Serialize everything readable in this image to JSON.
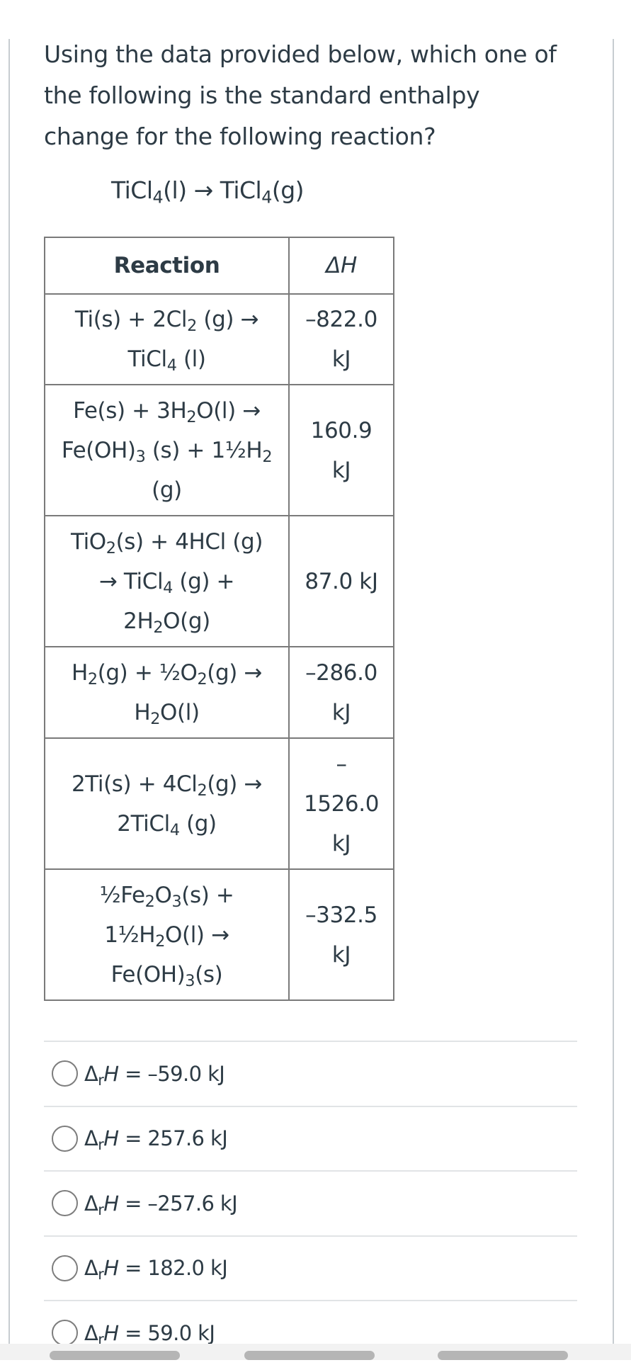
{
  "question": {
    "lines": [
      "Using the data provided below, which one of",
      "the following is the standard enthalpy",
      "change for the following reaction?"
    ],
    "equation": [
      {
        "t": "TiCl"
      },
      {
        "sub": "4"
      },
      {
        "t": "(l) → TiCl"
      },
      {
        "sub": "4"
      },
      {
        "t": "(g)"
      }
    ]
  },
  "table": {
    "headers": {
      "reaction": "Reaction",
      "delta_h": "ΔH"
    },
    "rows": [
      {
        "reaction_lines": [
          [
            {
              "t": "Ti(s) + 2Cl"
            },
            {
              "sub": "2"
            },
            {
              "t": " (g) →"
            }
          ],
          [
            {
              "t": "TiCl"
            },
            {
              "sub": "4"
            },
            {
              "t": " (l)"
            }
          ]
        ],
        "delta_h_lines": [
          "–822.0",
          "kJ"
        ]
      },
      {
        "reaction_lines": [
          [
            {
              "t": "Fe(s) + 3H"
            },
            {
              "sub": "2"
            },
            {
              "t": "O(l) →"
            }
          ],
          [
            {
              "t": "Fe(OH)"
            },
            {
              "sub": "3"
            },
            {
              "t": " (s) + 1½H"
            },
            {
              "sub": "2"
            }
          ],
          [
            {
              "t": "(g)"
            }
          ]
        ],
        "delta_h_lines": [
          "160.9",
          "kJ"
        ]
      },
      {
        "reaction_lines": [
          [
            {
              "t": "TiO"
            },
            {
              "sub": "2"
            },
            {
              "t": "(s) + 4HCl (g)"
            }
          ],
          [
            {
              "t": "→ TiCl"
            },
            {
              "sub": "4"
            },
            {
              "t": " (g) +"
            }
          ],
          [
            {
              "t": "2H"
            },
            {
              "sub": "2"
            },
            {
              "t": "O(g)"
            }
          ]
        ],
        "delta_h_lines": [
          "87.0 kJ"
        ]
      },
      {
        "reaction_lines": [
          [
            {
              "t": "H"
            },
            {
              "sub": "2"
            },
            {
              "t": "(g) + ½O"
            },
            {
              "sub": "2"
            },
            {
              "t": "(g) →"
            }
          ],
          [
            {
              "t": "H"
            },
            {
              "sub": "2"
            },
            {
              "t": "O(l)"
            }
          ]
        ],
        "delta_h_lines": [
          "–286.0",
          "kJ"
        ]
      },
      {
        "reaction_lines": [
          [
            {
              "t": "2Ti(s) + 4Cl"
            },
            {
              "sub": "2"
            },
            {
              "t": "(g) →"
            }
          ],
          [
            {
              "t": "2TiCl"
            },
            {
              "sub": "4"
            },
            {
              "t": " (g)"
            }
          ]
        ],
        "delta_h_lines": [
          "–",
          "1526.0",
          "kJ"
        ]
      },
      {
        "reaction_lines": [
          [
            {
              "t": "½Fe"
            },
            {
              "sub": "2"
            },
            {
              "t": "O"
            },
            {
              "sub": "3"
            },
            {
              "t": "(s) +"
            }
          ],
          [
            {
              "t": "1½H"
            },
            {
              "sub": "2"
            },
            {
              "t": "O(l) →"
            }
          ],
          [
            {
              "t": "Fe(OH)"
            },
            {
              "sub": "3"
            },
            {
              "t": "(s)"
            }
          ]
        ],
        "delta_h_lines": [
          "–332.5",
          "kJ"
        ]
      }
    ]
  },
  "options": [
    {
      "symbol": "Δ",
      "sub": "r",
      "var": "H",
      "value": " = –59.0 kJ",
      "selected": false
    },
    {
      "symbol": "Δ",
      "sub": "r",
      "var": "H",
      "value": " = 257.6 kJ",
      "selected": false
    },
    {
      "symbol": "Δ",
      "sub": "r",
      "var": "H",
      "value": " = –257.6 kJ",
      "selected": false
    },
    {
      "symbol": "Δ",
      "sub": "r",
      "var": "H",
      "value": " = 182.0 kJ",
      "selected": false
    },
    {
      "symbol": "Δ",
      "sub": "r",
      "var": "H",
      "value": " = 59.0 kJ",
      "selected": false
    }
  ],
  "icons": {
    "radio": "radio-unselected-circle",
    "nav_handle": "gray-pill-handle"
  },
  "colors": {
    "text": "#2d3b45",
    "table_border": "#7a7a7a",
    "option_divider": "#e1e4e6",
    "radio_border": "#7d7d7d",
    "bottom_bar": "#f2f2f2",
    "nav_pill": "#b5b5b5"
  }
}
